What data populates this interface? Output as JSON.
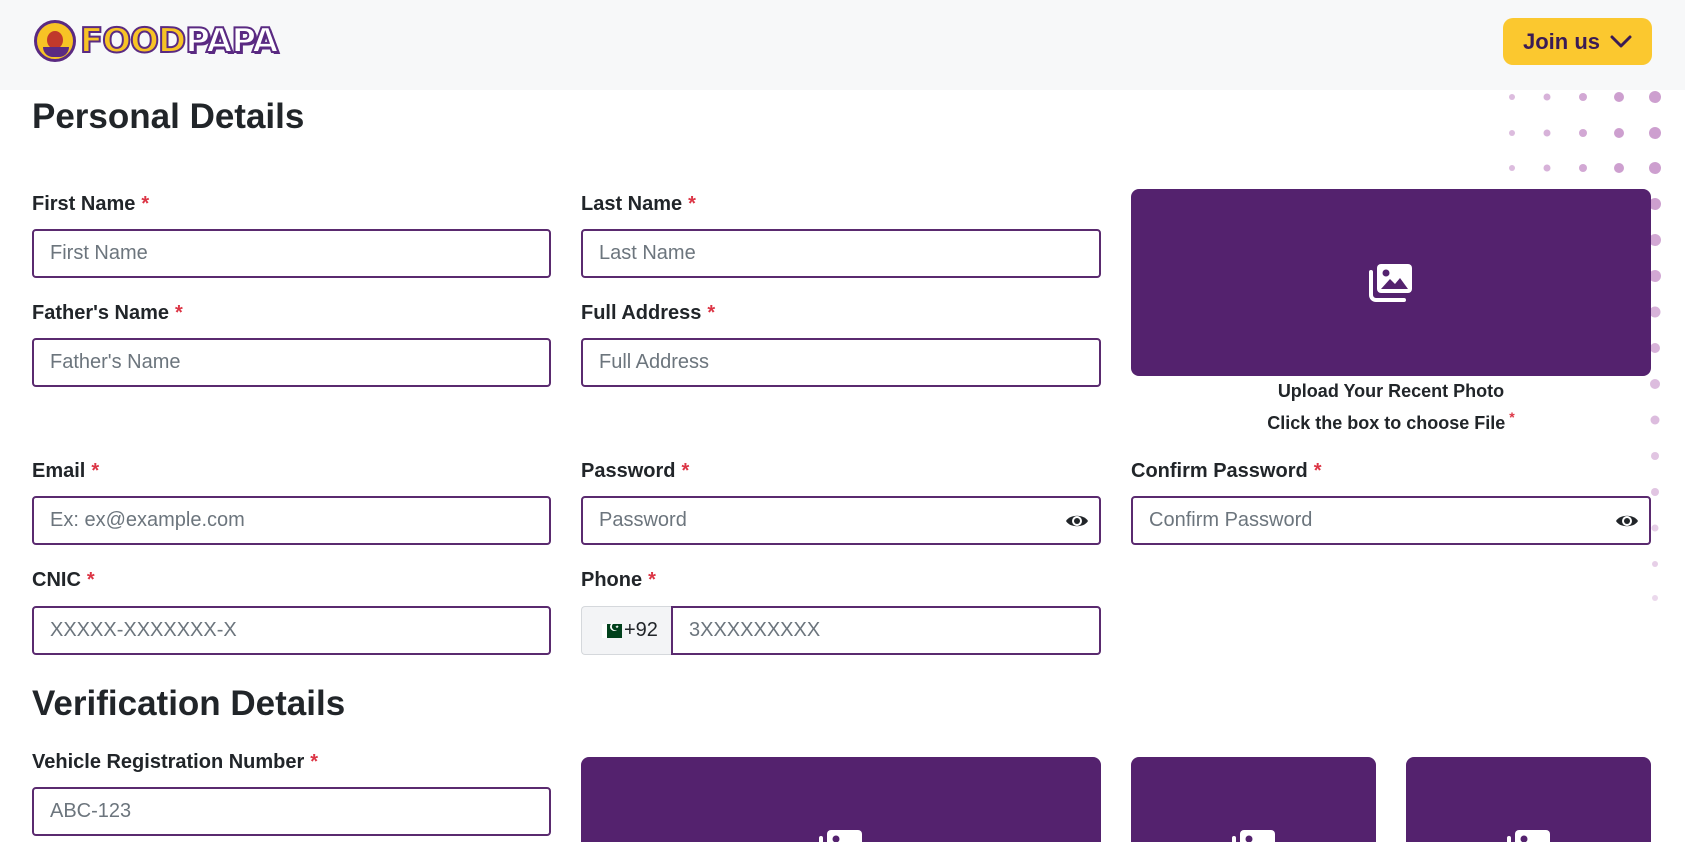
{
  "brand": {
    "logo_text_food": "FOOD",
    "logo_text_papa": "PAPA",
    "colors": {
      "primary": "#54226e",
      "accent": "#fbc82f",
      "required": "#dc3545",
      "input_border": "#5a2a6f"
    }
  },
  "header": {
    "join_label": "Join us",
    "join_icon": "chevron-down-icon"
  },
  "personal": {
    "title": "Personal Details",
    "required_mark": "*",
    "first_name": {
      "label": "First Name",
      "placeholder": "First Name"
    },
    "last_name": {
      "label": "Last Name",
      "placeholder": "Last Name"
    },
    "fathers_name": {
      "label": "Father's Name",
      "placeholder": "Father's Name"
    },
    "full_address": {
      "label": "Full Address",
      "placeholder": "Full Address"
    },
    "photo": {
      "icon": "images-icon",
      "caption_line1": "Upload Your Recent Photo",
      "caption_line2": "Click the box to choose File"
    },
    "email": {
      "label": "Email",
      "placeholder": "Ex: ex@example.com"
    },
    "password": {
      "label": "Password",
      "placeholder": "Password",
      "icon": "eye-icon"
    },
    "confirm_password": {
      "label": "Confirm Password",
      "placeholder": "Confirm Password",
      "icon": "eye-icon"
    },
    "cnic": {
      "label": "CNIC",
      "placeholder": "XXXXX-XXXXXXX-X"
    },
    "phone": {
      "label": "Phone",
      "country_code": "+92",
      "flag_icon": "pakistan-flag-icon",
      "placeholder": "3XXXXXXXXX"
    }
  },
  "verification": {
    "title": "Verification Details",
    "vehicle_reg": {
      "label": "Vehicle Registration Number",
      "placeholder": "ABC-123"
    },
    "upload_icon": "images-icon"
  }
}
